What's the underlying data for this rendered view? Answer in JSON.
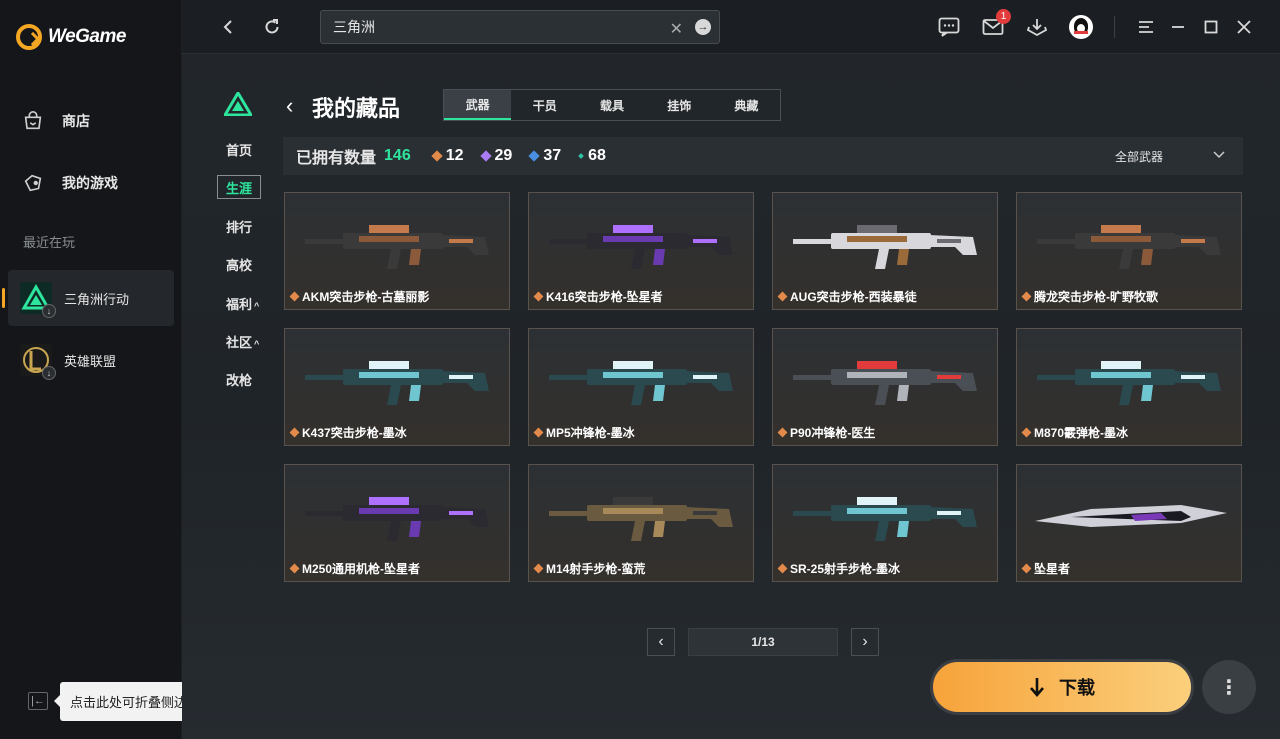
{
  "app": {
    "name": "WeGame"
  },
  "sidebar": {
    "nav": [
      {
        "label": "商店",
        "icon": "store-bag-icon"
      },
      {
        "label": "我的游戏",
        "icon": "gamepad-icon"
      }
    ],
    "recent_label": "最近在玩",
    "games": [
      {
        "label": "三角洲行动",
        "icon": "delta-force-icon",
        "active": true
      },
      {
        "label": "英雄联盟",
        "icon": "league-of-legends-icon",
        "active": false
      }
    ],
    "collapse_tip": "点击此处可折叠侧边栏"
  },
  "topbar": {
    "search_value": "三角洲",
    "mail_badge": "1"
  },
  "game_nav": {
    "items": [
      "首页",
      "生涯",
      "排行",
      "高校",
      "福利",
      "社区",
      "改枪"
    ],
    "active": "生涯"
  },
  "collection": {
    "title": "我的藏品",
    "tabs": [
      "武器",
      "干员",
      "载具",
      "挂饰",
      "典藏"
    ],
    "active_tab": "武器",
    "owned_label": "已拥有数量",
    "owned_count": "146",
    "rarity_counts": [
      {
        "value": "12",
        "color": "#e38a4a"
      },
      {
        "value": "29",
        "color": "#a77cf5"
      },
      {
        "value": "37",
        "color": "#4a90e2"
      },
      {
        "value": "68",
        "color": "#2ec4a3"
      }
    ],
    "filter_label": "全部武器",
    "items": [
      {
        "name": "AKM突击步枪-古墓丽影",
        "style": "rust"
      },
      {
        "name": "K416突击步枪-坠星者",
        "style": "purple"
      },
      {
        "name": "AUG突击步枪-西装暴徒",
        "style": "white"
      },
      {
        "name": "腾龙突击步枪-旷野牧歌",
        "style": "rust"
      },
      {
        "name": "K437突击步枪-墨冰",
        "style": "ice"
      },
      {
        "name": "MP5冲锋枪-墨冰",
        "style": "ice"
      },
      {
        "name": "P90冲锋枪-医生",
        "style": "steel"
      },
      {
        "name": "M870霰弹枪-墨冰",
        "style": "ice"
      },
      {
        "name": "M250通用机枪-坠星者",
        "style": "purple"
      },
      {
        "name": "M14射手步枪-蛮荒",
        "style": "tan"
      },
      {
        "name": "SR-25射手步枪-墨冰",
        "style": "ice"
      },
      {
        "name": "坠星者",
        "style": "blade"
      }
    ]
  },
  "pagination": {
    "indicator": "1/13"
  },
  "download": {
    "label": "下载"
  },
  "colors": {
    "accent": "#2ee59d",
    "brand": "#f5a623"
  }
}
